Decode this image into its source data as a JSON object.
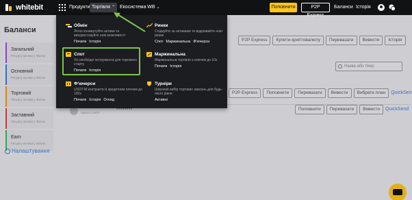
{
  "nav": {
    "logo_text": "whitebit",
    "products": "Продукти",
    "trading": "Торгівля",
    "ecosystem": "Екосистема WB",
    "topup": "Поповнити",
    "p2p": "P2P Express",
    "balances": "Баланси",
    "history": "Історія"
  },
  "sidebar": {
    "title": "Баланси",
    "items": [
      {
        "label": "Загальний",
        "sub": "Ресурсу активи у Фіатах",
        "color": "#a34bd0"
      },
      {
        "label": "Основний",
        "sub": "Ресурсу активи у Фіатах",
        "color": "#3f7cd8"
      },
      {
        "label": "Торговий",
        "sub": "Ресурсу активи у Фіатах",
        "color": "#e89a1a"
      },
      {
        "label": "Заставний",
        "sub": "Ресурсу активи у Фіатах",
        "color": "#d8404a"
      },
      {
        "label": "Earn",
        "sub": "Ресурсу активи у Фіатах",
        "color": "#3fb76a"
      }
    ],
    "settings": "Налаштування"
  },
  "main": {
    "row1": [
      "P2P Express",
      "Купити криптовалюту",
      "Перевазати",
      "Вивести",
      "Історія"
    ],
    "search_placeholder": "Назва або тікер",
    "row2": [
      "P2P Express",
      "Поповнити",
      "Перевазати",
      "Вивести",
      "Вибрати план"
    ],
    "quicksend": "QuickSend",
    "row3": [
      "Поповнити",
      "Перевазати",
      "Вивести"
    ],
    "coin_sub": "Криптo USDT",
    "dots": "••••••••"
  },
  "dropdown": {
    "items": [
      {
        "title": "Обмін",
        "desc": "Легко конвертуйте активи та використовуйте нові можливості",
        "links": [
          "Почати",
          "Історія"
        ],
        "icon": "exchange-icon"
      },
      {
        "title": "Ринки",
        "desc": "Слідкуйте за активами та відкривайте нові ринки",
        "links": [
          "Спот",
          "Маржинальна",
          "Ф'ючерси"
        ],
        "icon": "chart-icon"
      },
      {
        "title": "Спот",
        "desc": "Усі необхідні інструменти для торгового старту",
        "links": [
          "Почати",
          "Історія"
        ],
        "icon": "spot-icon"
      },
      {
        "title": "Маржинальна",
        "desc": "Маржинальна торгівля з плечем до 10x",
        "links": [
          "Почати",
          "Історія"
        ],
        "icon": "margin-icon"
      },
      {
        "title": "Ф'ючерси",
        "desc": "USDT-M контракти із кредитним плечем до 100x",
        "links": [
          "Почати",
          "Історія",
          "Огляд"
        ],
        "icon": "futures-icon"
      },
      {
        "title": "Турніри",
        "desc": "Широкий вибір торгових змагань для будь-якого рівня",
        "links": [
          "Активні"
        ],
        "icon": "trophy-icon"
      }
    ]
  },
  "colors": {
    "accent": "#ffc61a",
    "highlight": "#7cc64a",
    "link": "#3f7cd8"
  }
}
